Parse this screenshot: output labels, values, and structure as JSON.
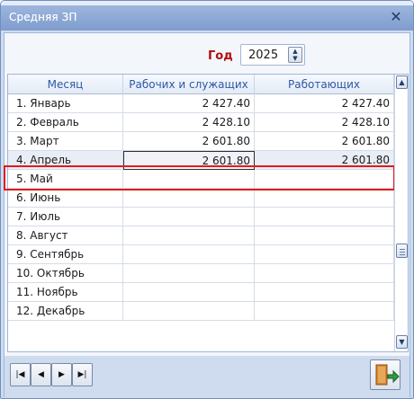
{
  "window": {
    "title": "Средняя ЗП",
    "close_icon": "close-icon"
  },
  "filter": {
    "year_label": "Год",
    "year_value": "2025"
  },
  "table": {
    "columns": [
      "Месяц",
      "Рабочих и служащих",
      "Работающих"
    ],
    "rows": [
      {
        "month": "1. Январь",
        "workers": "2 427.40",
        "employed": "2 427.40"
      },
      {
        "month": "2. Февраль",
        "workers": "2 428.10",
        "employed": "2 428.10"
      },
      {
        "month": "3. Март",
        "workers": "2 601.80",
        "employed": "2 601.80"
      },
      {
        "month": "4. Апрель",
        "workers": "2 601.80",
        "employed": "2 601.80"
      },
      {
        "month": "5. Май",
        "workers": "",
        "employed": ""
      },
      {
        "month": "6. Июнь",
        "workers": "",
        "employed": ""
      },
      {
        "month": "7. Июль",
        "workers": "",
        "employed": ""
      },
      {
        "month": "8. Август",
        "workers": "",
        "employed": ""
      },
      {
        "month": "9. Сентябрь",
        "workers": "",
        "employed": ""
      },
      {
        "month": "10. Октябрь",
        "workers": "",
        "employed": ""
      },
      {
        "month": "11. Ноябрь",
        "workers": "",
        "employed": ""
      },
      {
        "month": "12. Декабрь",
        "workers": "",
        "employed": ""
      }
    ],
    "selected_row": 3
  },
  "nav": {
    "first_icon": "first-record-icon",
    "prev_icon": "prev-record-icon",
    "next_icon": "next-record-icon",
    "last_icon": "last-record-icon",
    "exit_icon": "exit-door-icon"
  },
  "colors": {
    "accent": "#2b58a6",
    "year_label": "#b10e0e",
    "highlight": "#e21b1b",
    "frame": "#cfdcef"
  }
}
